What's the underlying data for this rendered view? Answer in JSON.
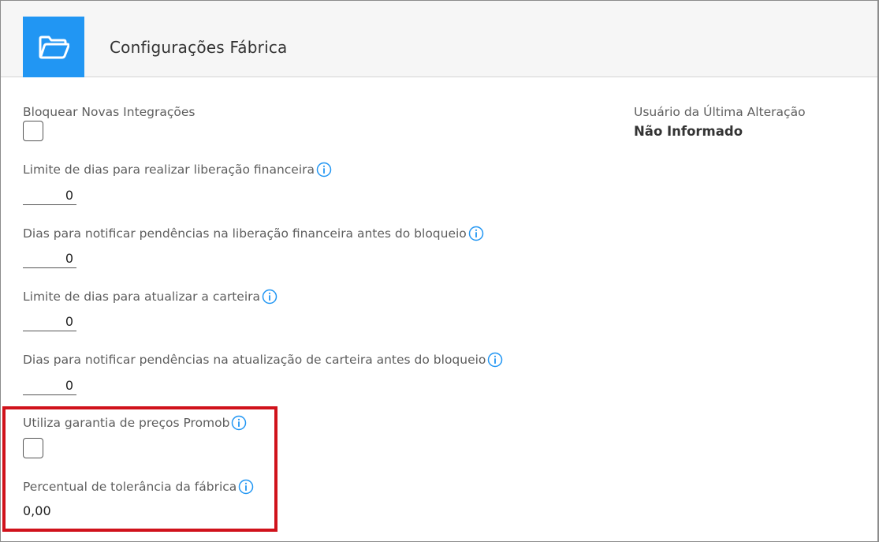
{
  "header": {
    "title": "Configurações Fábrica",
    "icon": "folder-icon",
    "accent_color": "#2196f3"
  },
  "fields": {
    "block_integrations": {
      "label": "Bloquear Novas Integrações",
      "checked": false
    },
    "financial_release_limit": {
      "label": "Limite de dias para realizar liberação financeira",
      "value": "0"
    },
    "financial_notify_days": {
      "label": "Dias para notificar pendências na liberação financeira antes do bloqueio",
      "value": "0"
    },
    "wallet_update_limit": {
      "label": "Limite de dias para atualizar a carteira",
      "value": "0"
    },
    "wallet_notify_days": {
      "label": "Dias para notificar pendências na atualização de carteira antes do bloqueio",
      "value": "0"
    },
    "promob_price_guarantee": {
      "label": "Utiliza garantia de preços Promob",
      "checked": false
    },
    "factory_tolerance": {
      "label": "Percentual de tolerância da fábrica",
      "value": "0,00"
    }
  },
  "last_change": {
    "label": "Usuário da Última Alteração",
    "value": "Não Informado"
  },
  "highlight_color": "#d0121b",
  "info_icon": "info-icon"
}
